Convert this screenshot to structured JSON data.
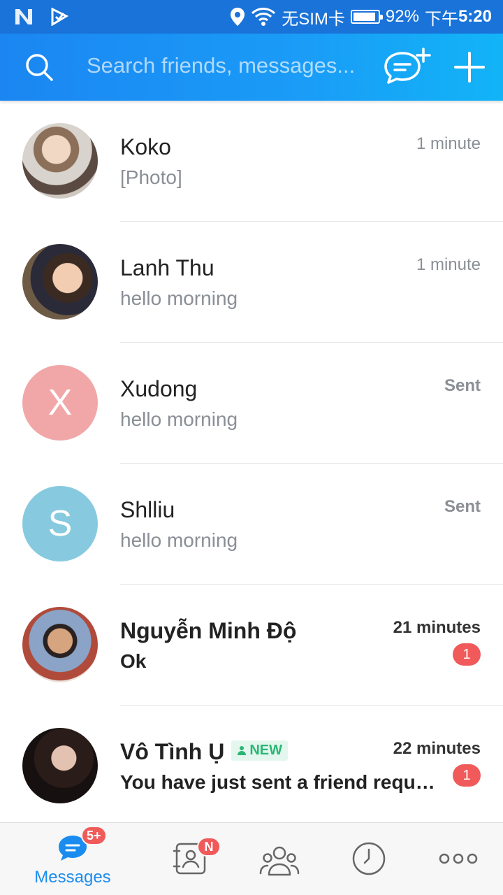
{
  "status_bar": {
    "sim_text": "无SIM卡",
    "battery_percent_text": "92%",
    "battery_level": 0.92,
    "time_prefix": "下午",
    "time": "5:20"
  },
  "header": {
    "search_placeholder": "Search friends, messages..."
  },
  "chats": [
    {
      "name": "Koko",
      "preview": "[Photo]",
      "time": "1 minute",
      "avatar": "photo",
      "unread": null
    },
    {
      "name": "Lanh Thu",
      "preview": "hello morning",
      "time": "1 minute",
      "avatar": "photo",
      "unread": null
    },
    {
      "name": "Xudong",
      "preview": "hello morning",
      "time": "Sent",
      "avatar_letter": "X",
      "unread": null
    },
    {
      "name": "Shlliu",
      "preview": "hello morning",
      "time": "Sent",
      "avatar_letter": "S",
      "unread": null
    },
    {
      "name": "Nguyễn Minh Độ",
      "preview": "Ok",
      "time": "21 minutes",
      "avatar": "photo",
      "unread": "1"
    },
    {
      "name": "Vô Tình Ụ",
      "tag": "NEW",
      "preview": "You have just sent a friend request...",
      "time": "22 minutes",
      "avatar": "photo",
      "unread": "1"
    }
  ],
  "bottom_nav": {
    "messages_label": "Messages",
    "messages_badge": "5+",
    "contacts_badge": "N"
  },
  "colors": {
    "accent": "#1a8cf0",
    "badge": "#f05a5a",
    "new_tag": "#2bb673"
  }
}
